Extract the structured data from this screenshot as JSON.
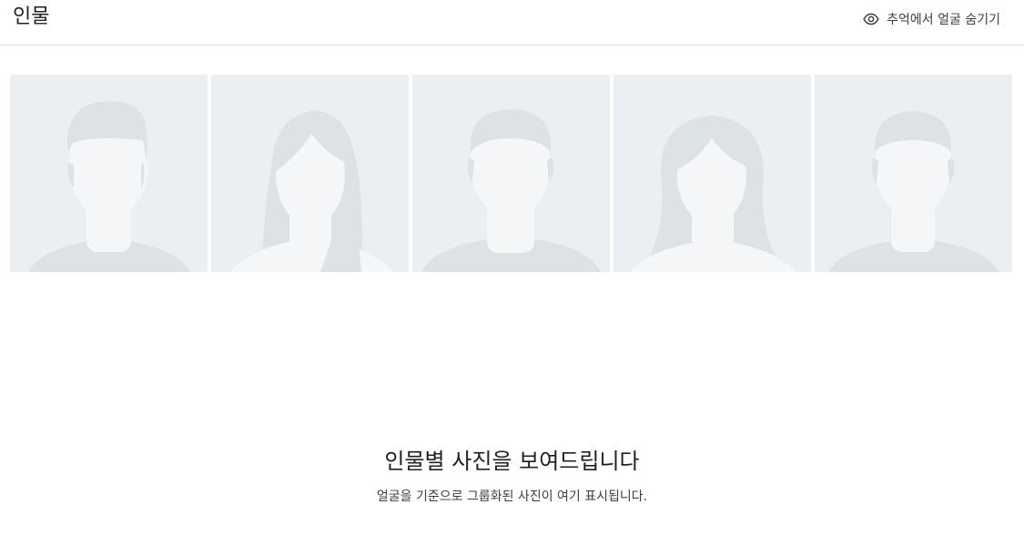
{
  "header": {
    "title": "인물",
    "hide_faces_label": "추억에서 얼굴 숨기기",
    "hide_faces_icon": "eye-icon"
  },
  "placeholders": [
    {
      "kind": "man-short-hair"
    },
    {
      "kind": "woman-long-hair"
    },
    {
      "kind": "man-short-hair"
    },
    {
      "kind": "woman-medium-hair"
    },
    {
      "kind": "man-short-hair"
    }
  ],
  "empty_state": {
    "title": "인물별 사진을 보여드립니다",
    "subtitle": "얼굴을 기준으로 그룹화된 사진이 여기 표시됩니다."
  },
  "colors": {
    "tile_bg": "#ebeff2",
    "hair": "#dde2e5",
    "skin": "#f4f6f8",
    "shirt": "#dde2e5",
    "divider": "#dadce0"
  }
}
